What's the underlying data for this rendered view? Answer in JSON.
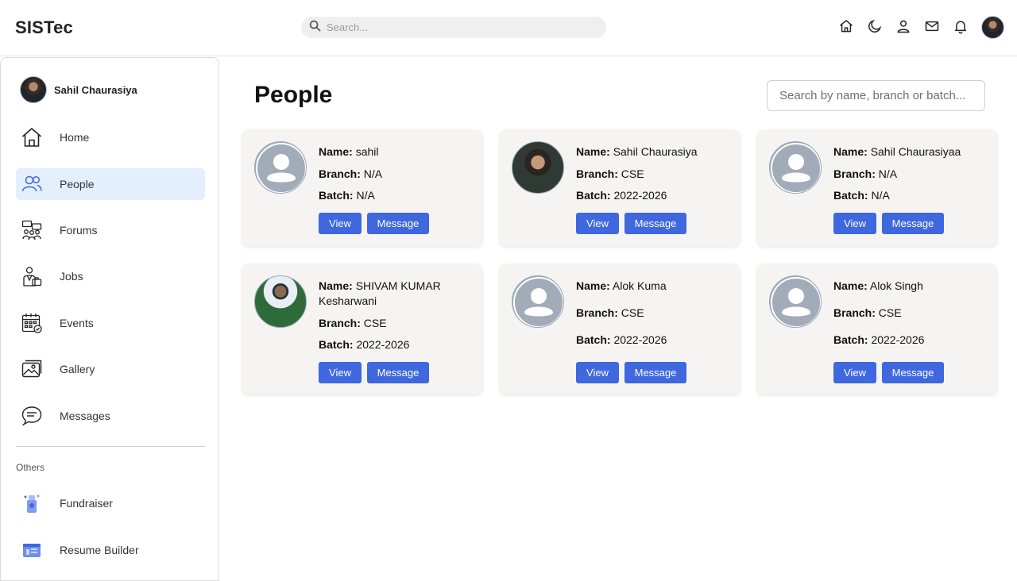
{
  "brand": "SISTec",
  "top_search": {
    "placeholder": "Search..."
  },
  "top_icons": [
    "home-icon",
    "moon-icon",
    "user-icon",
    "mail-icon",
    "bell-icon"
  ],
  "sidebar": {
    "user_name": "Sahil Chaurasiya",
    "items": [
      {
        "label": "Home",
        "icon": "home-icon",
        "active": false
      },
      {
        "label": "People",
        "icon": "people-icon",
        "active": true
      },
      {
        "label": "Forums",
        "icon": "forums-icon",
        "active": false
      },
      {
        "label": "Jobs",
        "icon": "jobs-icon",
        "active": false
      },
      {
        "label": "Events",
        "icon": "calendar-icon",
        "active": false
      },
      {
        "label": "Gallery",
        "icon": "gallery-icon",
        "active": false
      },
      {
        "label": "Messages",
        "icon": "messages-icon",
        "active": false
      }
    ],
    "others_label": "Others",
    "others": [
      {
        "label": "Fundraiser",
        "icon": "fundraiser-icon"
      },
      {
        "label": "Resume Builder",
        "icon": "resume-builder-icon"
      }
    ]
  },
  "main": {
    "title": "People",
    "search_placeholder": "Search by name, branch or batch...",
    "labels": {
      "name": "Name:",
      "branch": "Branch:",
      "batch": "Batch:",
      "view": "View",
      "message": "Message"
    },
    "people": [
      {
        "name": "sahil",
        "branch": "N/A",
        "batch": "N/A",
        "avatar": "default"
      },
      {
        "name": "Sahil Chaurasiya",
        "branch": "CSE",
        "batch": "2022-2026",
        "avatar": "photo"
      },
      {
        "name": "Sahil Chaurasiyaa",
        "branch": "N/A",
        "batch": "N/A",
        "avatar": "default"
      },
      {
        "name": "SHIVAM KUMAR Kesharwani",
        "branch": "CSE",
        "batch": "2022-2026",
        "avatar": "photo"
      },
      {
        "name": "Alok Kuma",
        "branch": "CSE",
        "batch": "2022-2026",
        "avatar": "default"
      },
      {
        "name": "Alok Singh",
        "branch": "CSE",
        "batch": "2022-2026",
        "avatar": "default"
      }
    ]
  },
  "colors": {
    "accent": "#3f67de",
    "active_nav": "#e4effd",
    "card_bg": "#f5f4f2"
  }
}
